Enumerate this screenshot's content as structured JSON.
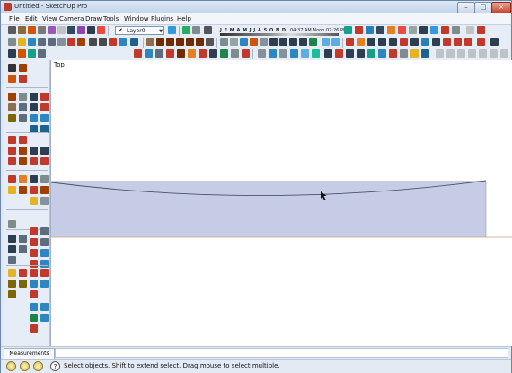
{
  "window": {
    "title": "Untitled - SketchUp Pro",
    "minimize_glyph": "–",
    "maximize_glyph": "□",
    "close_glyph": "×"
  },
  "menu": [
    "File",
    "Edit",
    "View",
    "Camera",
    "Draw",
    "Tools",
    "Window",
    "Plugins",
    "Help"
  ],
  "toolbar": {
    "layer_value": "Layer0",
    "layer_check": "✔",
    "layer_arrow": "▼",
    "shadow_months": "J F M A M J J A S O N D",
    "shadow_time": "04:37 AM   Noon   07:26 PM"
  },
  "viewport": {
    "scene_label": "Top"
  },
  "measurements": {
    "label": "Measurements",
    "value": ""
  },
  "status": {
    "help_glyph": "?",
    "text": "Select objects. Shift to extend select. Drag mouse to select multiple."
  },
  "colors": {
    "face": "#c6cbe6",
    "edge": "#4a5568",
    "accent": "#c0392b"
  }
}
